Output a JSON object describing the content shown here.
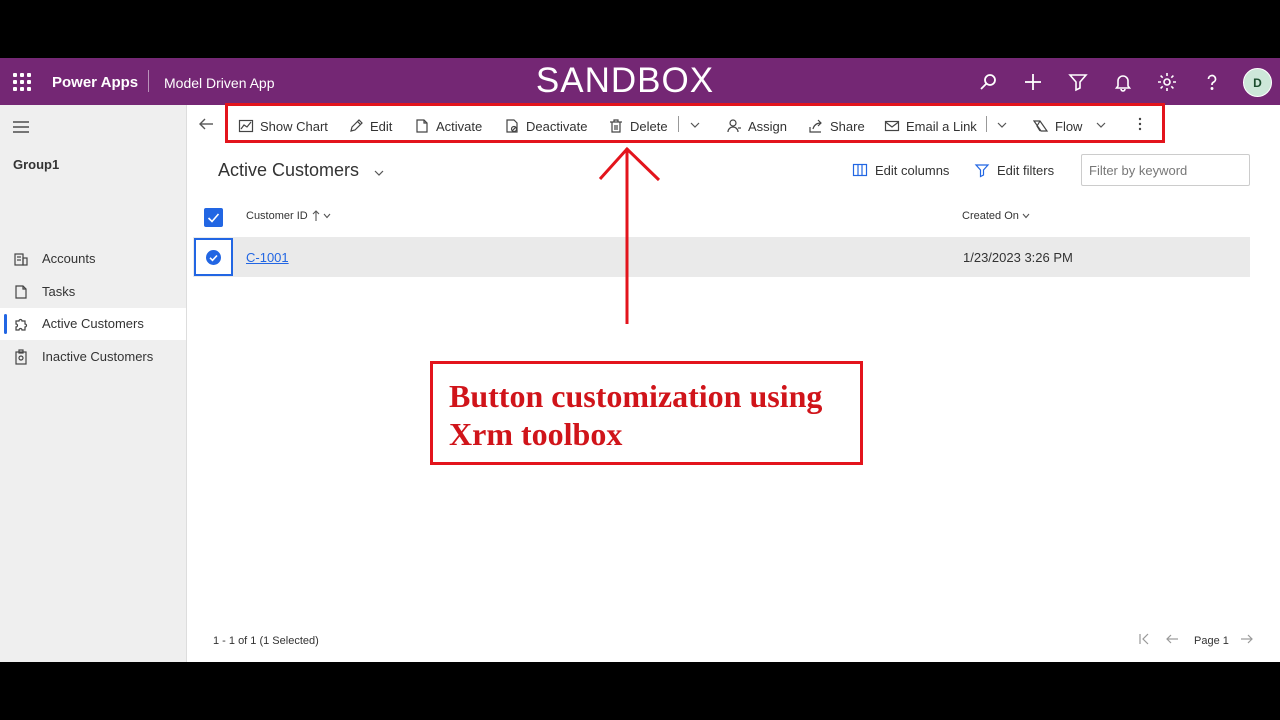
{
  "topbar": {
    "app_name": "Power Apps",
    "env_name": "Model Driven App",
    "sandbox_label": "SANDBOX",
    "avatar_initial": "D",
    "brand_color": "#742774"
  },
  "sidebar": {
    "group_label": "Group1",
    "items": [
      {
        "label": "Accounts",
        "icon": "accounts-icon"
      },
      {
        "label": "Tasks",
        "icon": "tasks-icon"
      },
      {
        "label": "Active Customers",
        "icon": "puzzle-icon",
        "active": true
      },
      {
        "label": "Inactive Customers",
        "icon": "badge-icon"
      }
    ]
  },
  "commands": {
    "show_chart": "Show Chart",
    "edit": "Edit",
    "activate": "Activate",
    "deactivate": "Deactivate",
    "delete": "Delete",
    "assign": "Assign",
    "share": "Share",
    "email_link": "Email a Link",
    "flow": "Flow"
  },
  "view": {
    "title": "Active Customers",
    "edit_columns": "Edit columns",
    "edit_filters": "Edit filters",
    "filter_placeholder": "Filter by keyword"
  },
  "grid": {
    "columns": [
      "Customer ID",
      "Created On"
    ],
    "rows": [
      {
        "customer_id": "C-1001",
        "created_on": "1/23/2023 3:26 PM",
        "selected": true
      }
    ]
  },
  "annotation": {
    "text": "Button customization using Xrm toolbox",
    "color": "#e3141c"
  },
  "footer": {
    "record_count": "1 - 1 of 1 (1 Selected)",
    "page_label": "Page 1"
  }
}
